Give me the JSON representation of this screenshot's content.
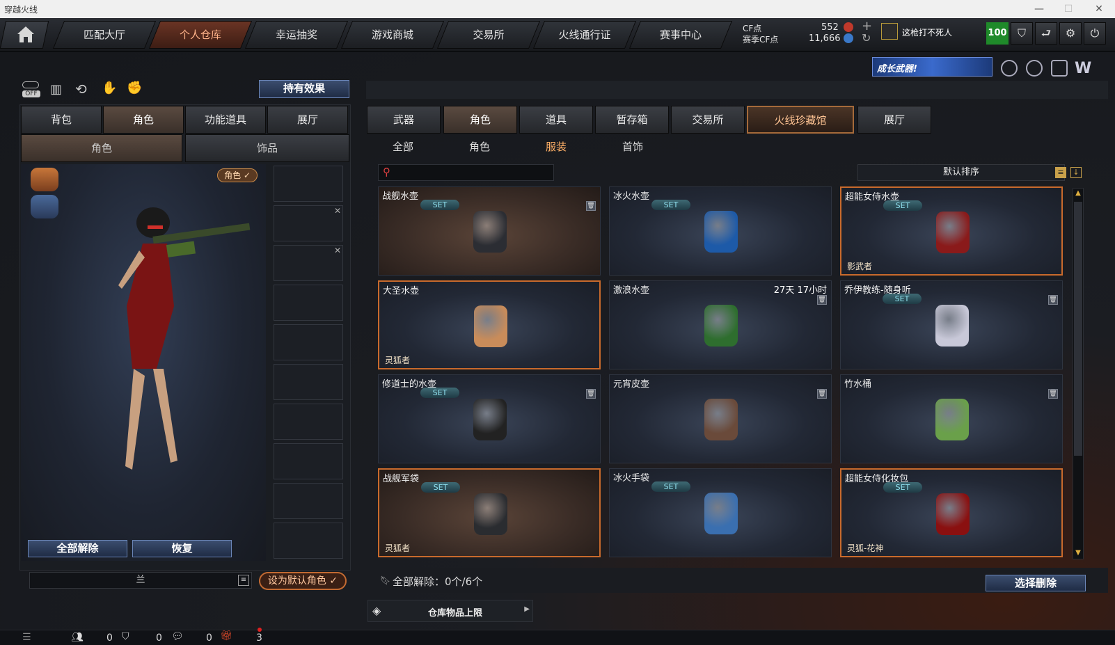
{
  "window": {
    "title": "穿越火线",
    "min": "—",
    "max": "☐",
    "close": "✕"
  },
  "nav": {
    "home_icon": "home-icon",
    "tabs": [
      "匹配大厅",
      "个人仓库",
      "幸运抽奖",
      "游戏商城",
      "交易所",
      "火线通行证",
      "赛事中心"
    ],
    "active": "个人仓库"
  },
  "currency": {
    "cf_label": "CF点",
    "cf_value": "552",
    "season_label": "赛季CF点",
    "season_value": "11,666",
    "plus": "+",
    "refresh": "↻"
  },
  "user": {
    "name": "这枪打不死人",
    "level": "100"
  },
  "toolbar_icons": [
    "off-toggle",
    "chart-icon",
    "replay-icon",
    "gesture-icon",
    "mouse-icon"
  ],
  "off_label": "OFF",
  "banner": {
    "text": "成长武器!"
  },
  "left": {
    "hold_effect": "持有效果",
    "tabs": [
      "背包",
      "角色",
      "功能道具",
      "展厅"
    ],
    "active_tab": "角色",
    "subtabs": [
      "角色",
      "饰品"
    ],
    "role_badge": "角色 ✓",
    "unequip_all": "全部解除",
    "restore": "恢复",
    "role_name": "兰",
    "set_default": "设为默认角色 ✓"
  },
  "right": {
    "tabs": [
      "武器",
      "角色",
      "道具",
      "暂存箱",
      "交易所",
      "火线珍藏馆",
      "展厅"
    ],
    "active_tab": "角色",
    "gold_tab": "火线珍藏馆",
    "subtabs": [
      "全部",
      "角色",
      "服装",
      "首饰"
    ],
    "active_sub": "服装",
    "search_placeholder": "",
    "sort": "默认排序",
    "items": [
      {
        "name": "战舰水壶",
        "set": "SET",
        "trash": true,
        "owner": "",
        "timer": "",
        "warm": true,
        "selected": false,
        "color": "#2b2d33"
      },
      {
        "name": "冰火水壶",
        "set": "SET",
        "trash": false,
        "owner": "",
        "timer": "",
        "warm": false,
        "selected": false,
        "color": "#1d5aa8"
      },
      {
        "name": "超能女侍水壶",
        "set": "SET",
        "trash": false,
        "owner": "影武者",
        "timer": "",
        "warm": false,
        "selected": true,
        "color": "#8a1a1a"
      },
      {
        "name": "大圣水壶",
        "set": "",
        "trash": false,
        "owner": "灵狐者",
        "timer": "",
        "warm": false,
        "selected": true,
        "color": "#c98c5a"
      },
      {
        "name": "激浪水壶",
        "set": "",
        "trash": true,
        "owner": "",
        "timer": "27天 17小时",
        "warm": false,
        "selected": false,
        "color": "#2e6e2e"
      },
      {
        "name": "乔伊教练-随身听",
        "set": "SET",
        "trash": true,
        "owner": "",
        "timer": "",
        "warm": false,
        "selected": false,
        "color": "#c8c8d8"
      },
      {
        "name": "修道士的水壶",
        "set": "SET",
        "trash": true,
        "owner": "",
        "timer": "",
        "warm": false,
        "selected": false,
        "color": "#222"
      },
      {
        "name": "元宵皮壶",
        "set": "",
        "trash": true,
        "owner": "",
        "timer": "",
        "warm": false,
        "selected": false,
        "color": "#6a4a3a"
      },
      {
        "name": "竹水桶",
        "set": "",
        "trash": true,
        "owner": "",
        "timer": "",
        "warm": false,
        "selected": false,
        "color": "#6aa04a"
      },
      {
        "name": "战舰军袋",
        "set": "SET",
        "trash": false,
        "owner": "灵狐者",
        "timer": "",
        "warm": true,
        "selected": true,
        "color": "#2a2c30"
      },
      {
        "name": "冰火手袋",
        "set": "SET",
        "trash": false,
        "owner": "",
        "timer": "",
        "warm": false,
        "selected": false,
        "color": "#3a6fb0"
      },
      {
        "name": "超能女侍化妆包",
        "set": "SET",
        "trash": false,
        "owner": "灵狐-花神",
        "timer": "",
        "warm": false,
        "selected": true,
        "color": "#8a1010"
      }
    ],
    "unequip_summary": "全部解除：0个/6个",
    "select_delete": "选择删除",
    "storage_limit": "仓库物品上限"
  },
  "status": {
    "c1": "0",
    "c2": "0",
    "c3": "0",
    "c4": "3"
  }
}
